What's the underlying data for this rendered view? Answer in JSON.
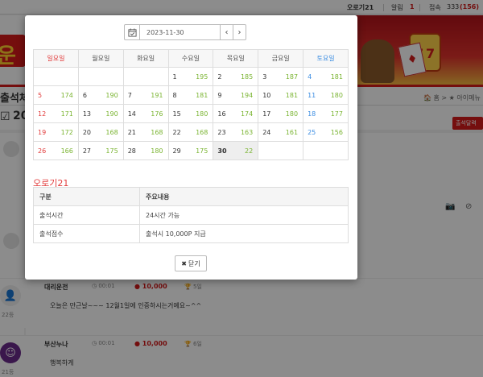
{
  "topbar": {
    "username": "오로기21",
    "alarm_label": "알림",
    "alarm_count": "1",
    "online_label": "접속",
    "online_count": "333",
    "online_extra": "(156)"
  },
  "page": {
    "section_label": "출석체",
    "breadcrumb": "🏠 홈 > ★ 아이메뉴",
    "date_heading": "20",
    "action_button": "출석달력"
  },
  "posts": [
    {
      "author": "대리운전",
      "time": "00:01",
      "points": "10,000",
      "rank": "5일",
      "rank_label": "22등",
      "message": "오늘은 만근날~~~ 12월1일에 인증하시는거예요~^^"
    },
    {
      "author": "부산누나",
      "time": "00:01",
      "points": "10,000",
      "rank": "6일",
      "rank_label": "21등",
      "message": "행복하게"
    }
  ],
  "modal": {
    "date_value": "2023-11-30",
    "prev_label": "‹",
    "next_label": "›",
    "weekdays": [
      "일요일",
      "월요일",
      "화요일",
      "수요일",
      "목요일",
      "금요일",
      "토요일"
    ],
    "weeks": [
      [
        {
          "d": "",
          "c": ""
        },
        {
          "d": "",
          "c": ""
        },
        {
          "d": "",
          "c": ""
        },
        {
          "d": "1",
          "c": "195"
        },
        {
          "d": "2",
          "c": "185"
        },
        {
          "d": "3",
          "c": "187"
        },
        {
          "d": "4",
          "c": "181"
        }
      ],
      [
        {
          "d": "5",
          "c": "174"
        },
        {
          "d": "6",
          "c": "190"
        },
        {
          "d": "7",
          "c": "191"
        },
        {
          "d": "8",
          "c": "181"
        },
        {
          "d": "9",
          "c": "194"
        },
        {
          "d": "10",
          "c": "181"
        },
        {
          "d": "11",
          "c": "180"
        }
      ],
      [
        {
          "d": "12",
          "c": "171"
        },
        {
          "d": "13",
          "c": "190"
        },
        {
          "d": "14",
          "c": "176"
        },
        {
          "d": "15",
          "c": "180"
        },
        {
          "d": "16",
          "c": "174"
        },
        {
          "d": "17",
          "c": "180"
        },
        {
          "d": "18",
          "c": "177"
        }
      ],
      [
        {
          "d": "19",
          "c": "172"
        },
        {
          "d": "20",
          "c": "168"
        },
        {
          "d": "21",
          "c": "168"
        },
        {
          "d": "22",
          "c": "168"
        },
        {
          "d": "23",
          "c": "163"
        },
        {
          "d": "24",
          "c": "161"
        },
        {
          "d": "25",
          "c": "156"
        }
      ],
      [
        {
          "d": "26",
          "c": "166"
        },
        {
          "d": "27",
          "c": "175"
        },
        {
          "d": "28",
          "c": "180"
        },
        {
          "d": "29",
          "c": "175"
        },
        {
          "d": "30",
          "c": "22"
        },
        {
          "d": "",
          "c": ""
        },
        {
          "d": "",
          "c": ""
        }
      ]
    ],
    "today": "30",
    "section_title": "오로기21",
    "info_headers": [
      "구분",
      "주요내용"
    ],
    "info_rows": [
      [
        "출석시간",
        "24시간 가능"
      ],
      [
        "출석점수",
        "출석시 10,000P 지급"
      ]
    ],
    "close_icon": "✖",
    "close_label": "닫기"
  },
  "colors": {
    "brand_red": "#d61b1b",
    "sunday": "#e23b3b",
    "saturday": "#3b8de2",
    "count_green": "#7ab431"
  },
  "icons": [
    "calendar-icon",
    "user-icon",
    "flag-icon",
    "camera-icon",
    "compass-icon",
    "clock-icon",
    "coin-icon",
    "trophy-icon",
    "home-icon",
    "close-icon"
  ]
}
